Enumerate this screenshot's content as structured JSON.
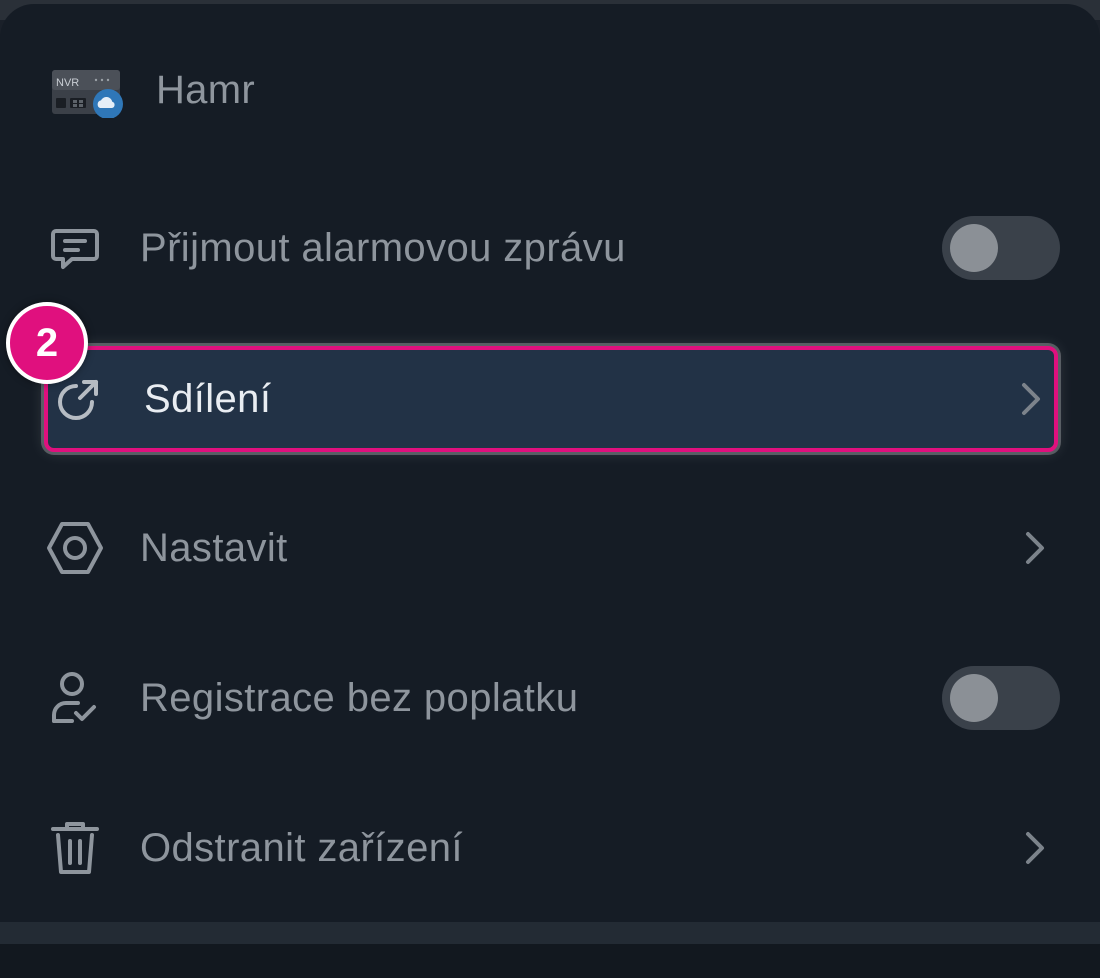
{
  "device": {
    "name": "Hamr",
    "thumbnail_text": "NVR",
    "thumbnail_icon": "nvr-cloud-icon"
  },
  "menu": [
    {
      "id": "alarm",
      "label": "Přijmout alarmovou zprávu",
      "icon": "message-icon",
      "control": "toggle",
      "toggle_on": false
    },
    {
      "id": "share",
      "label": "Sdílení",
      "icon": "share-icon",
      "control": "chevron",
      "highlighted": true
    },
    {
      "id": "settings",
      "label": "Nastavit",
      "icon": "settings-hex-icon",
      "control": "chevron"
    },
    {
      "id": "registration",
      "label": "Registrace bez poplatku",
      "icon": "user-check-icon",
      "control": "toggle",
      "toggle_on": false
    },
    {
      "id": "remove",
      "label": "Odstranit zařízení",
      "icon": "trash-icon",
      "control": "chevron"
    }
  ],
  "annotation": {
    "step_number": "2",
    "color": "#e0107e"
  },
  "colors": {
    "background": "#151c25",
    "highlight_fill": "#223246",
    "text_muted": "#8e959d",
    "text_active": "#e9edf2"
  }
}
